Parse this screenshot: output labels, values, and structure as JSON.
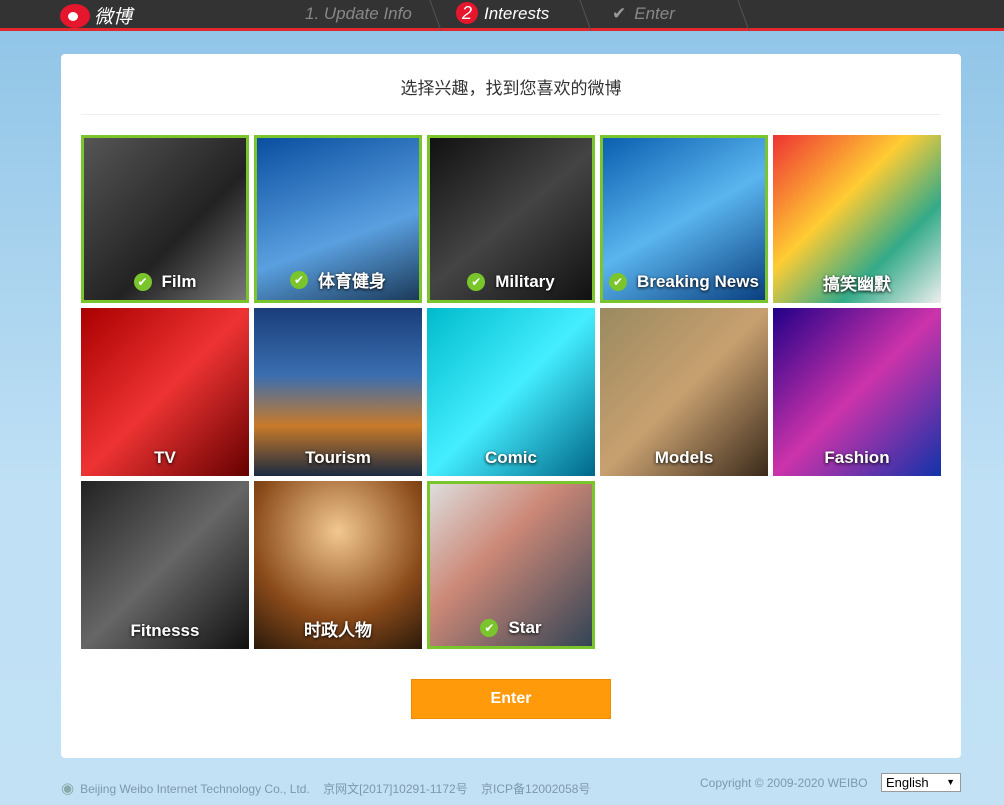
{
  "header": {
    "logo_text": "微博",
    "steps": [
      {
        "label": "1. Update Info",
        "state": "done"
      },
      {
        "number": "2",
        "label": "Interests",
        "state": "active"
      },
      {
        "label": "Enter",
        "state": "pending",
        "icon": "check-icon"
      }
    ]
  },
  "main": {
    "title": "选择兴趣，找到您喜欢的微博",
    "enter_label": "Enter",
    "tiles": [
      {
        "label": "Film",
        "selected": true
      },
      {
        "label": "体育健身",
        "selected": true
      },
      {
        "label": "Military",
        "selected": true
      },
      {
        "label": "Breaking News",
        "selected": true
      },
      {
        "label": "搞笑幽默",
        "selected": false
      },
      {
        "label": "TV",
        "selected": false
      },
      {
        "label": "Tourism",
        "selected": false
      },
      {
        "label": "Comic",
        "selected": false
      },
      {
        "label": "Models",
        "selected": false
      },
      {
        "label": "Fashion",
        "selected": false
      },
      {
        "label": "Fitnesss",
        "selected": false
      },
      {
        "label": "时政人物",
        "selected": false
      },
      {
        "label": "Star",
        "selected": true
      }
    ]
  },
  "footer": {
    "company": "Beijing Weibo Internet Technology Co., Ltd.",
    "license1": "京网文[2017]10291-1172号",
    "license2": "京ICP备12002058号",
    "copyright": "Copyright © 2009-2020 WEIBO",
    "language": "English"
  },
  "colors": {
    "accent": "#ff9b0b",
    "selected": "#7ac52b",
    "brand": "#e6162d"
  }
}
